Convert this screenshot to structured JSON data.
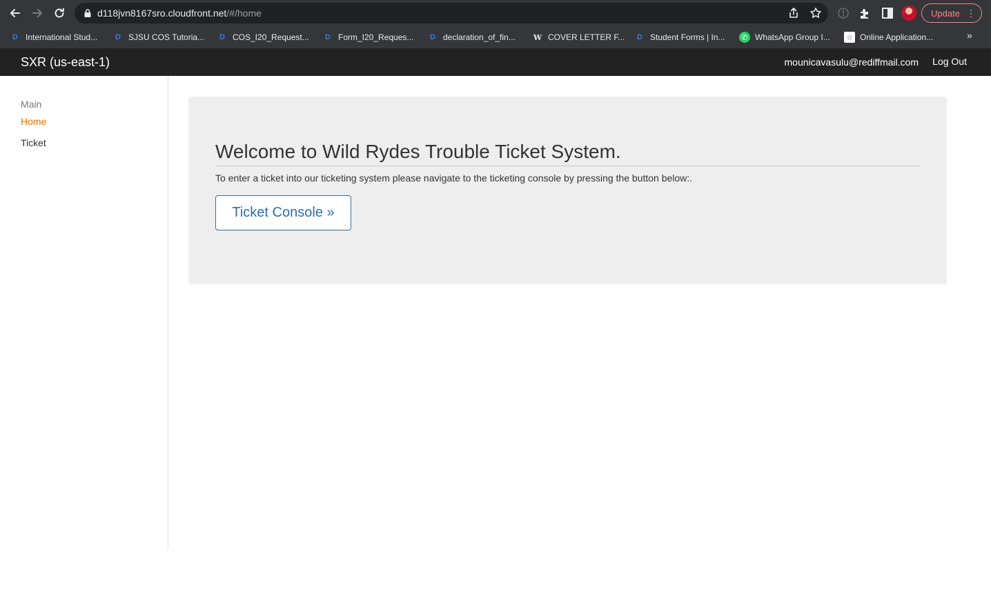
{
  "browser": {
    "url_host": "d118jvn8167sro.cloudfront.net",
    "url_path": "/#/home",
    "update_label": "Update",
    "bookmarks": [
      {
        "label": "International Stud...",
        "icon": "d2l-icon"
      },
      {
        "label": "SJSU COS Tutoria...",
        "icon": "d2l-icon"
      },
      {
        "label": "COS_I20_Request...",
        "icon": "d2l-icon"
      },
      {
        "label": "Form_I20_Reques...",
        "icon": "d2l-icon"
      },
      {
        "label": "declaration_of_fin...",
        "icon": "d2l-icon"
      },
      {
        "label": "COVER LETTER F...",
        "icon": "w-icon"
      },
      {
        "label": "Student Forms | In...",
        "icon": "d2l-icon"
      },
      {
        "label": "WhatsApp Group I...",
        "icon": "whatsapp-icon"
      },
      {
        "label": "Online Application...",
        "icon": "star-icon"
      }
    ],
    "more_bookmarks": "»"
  },
  "navbar": {
    "brand": "SXR (us-east-1)",
    "user_email": "mounicavasulu@rediffmail.com",
    "logout_label": "Log Out"
  },
  "sidebar": {
    "heading": "Main",
    "items": [
      {
        "label": "Home",
        "active": true
      },
      {
        "label": "Ticket",
        "active": false
      }
    ]
  },
  "main": {
    "title": "Welcome to Wild Rydes Trouble Ticket System.",
    "description": "To enter a ticket into our ticketing system please navigate to the ticketing console by pressing the button below:.",
    "button_label": "Ticket Console »"
  },
  "colors": {
    "accent_active": "#e57000",
    "button_blue": "#2e6da4",
    "navbar_bg": "#222222",
    "jumbotron_bg": "#eeeeee"
  }
}
